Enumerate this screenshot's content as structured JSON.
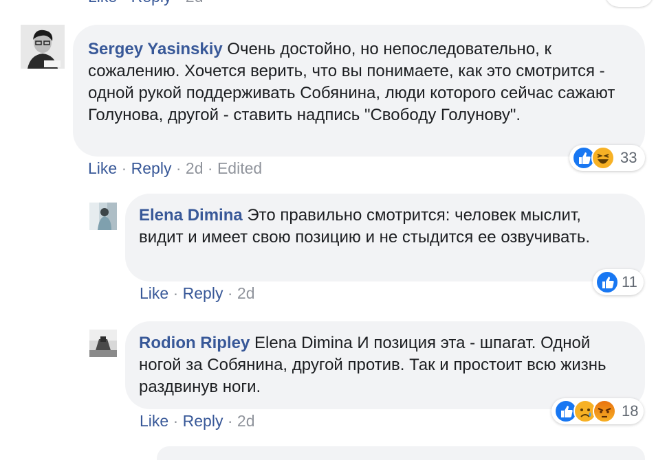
{
  "previous_comment": {
    "like_label": "Like",
    "reply_label": "Reply",
    "time": "2d",
    "separator": "·"
  },
  "comments": [
    {
      "author": "Sergey Yasinskiy",
      "text": "Очень достойно, но непоследовательно, к сожалению. Хочется верить, что вы понимаете, как это смотрится - одной рукой поддерживать Собянина, люди которого сейчас сажают Голунова, другой - ставить надпись \"Свободу Голунову\".",
      "like_label": "Like",
      "reply_label": "Reply",
      "time": "2d",
      "edited_label": "Edited",
      "separator": "·",
      "reactions": {
        "types": [
          "like-icon",
          "haha-icon"
        ],
        "count": "33"
      }
    },
    {
      "author": "Elena Dimina",
      "text": "Это правильно смотрится: человек мыслит, видит и имеет свою позицию и не стыдится ее озвучивать.",
      "like_label": "Like",
      "reply_label": "Reply",
      "time": "2d",
      "separator": "·",
      "reactions": {
        "types": [
          "like-icon"
        ],
        "count": "11"
      }
    },
    {
      "author": "Rodion Ripley",
      "text": "Elena Dimina И позиция эта - шпагат. Одной ногой за Собянина, другой против. Так и простоит всю жизнь раздвинув ноги.",
      "like_label": "Like",
      "reply_label": "Reply",
      "time": "2d",
      "separator": "·",
      "reactions": {
        "types": [
          "like-icon",
          "sad-icon",
          "angry-icon"
        ],
        "count": "18"
      }
    }
  ],
  "colors": {
    "link": "#385898",
    "meta": "#90949c",
    "bubble": "#f2f3f5",
    "like": "#1877f2",
    "emoji": "#f7b125",
    "angry": "#e9710f"
  }
}
